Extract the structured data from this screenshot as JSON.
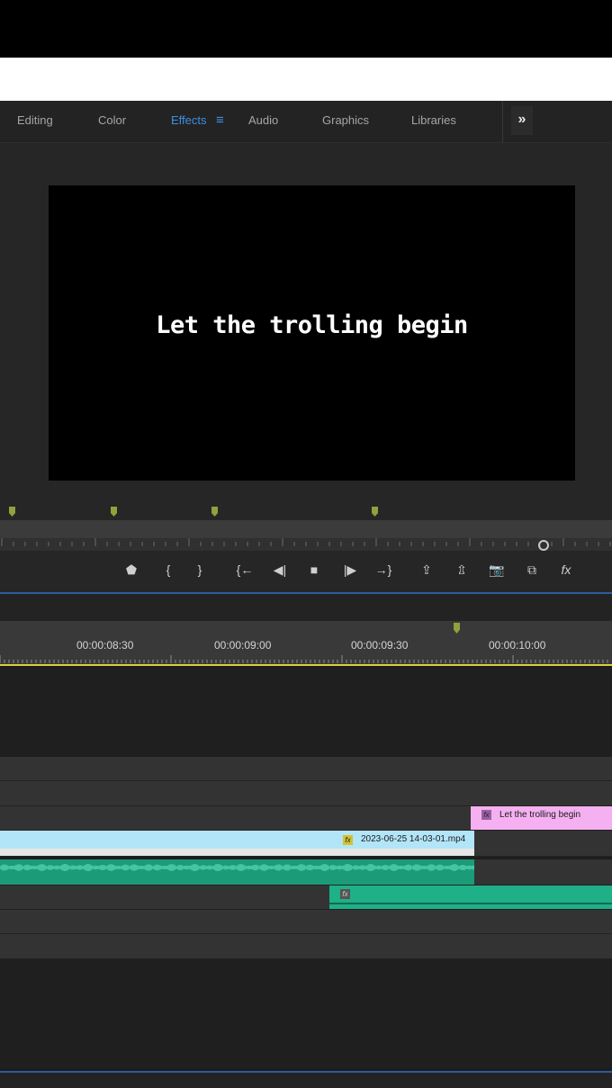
{
  "workspace_tabs": [
    {
      "label": "Editing",
      "active": false
    },
    {
      "label": "Color",
      "active": false
    },
    {
      "label": "Effects",
      "active": true
    },
    {
      "label": "Audio",
      "active": false
    },
    {
      "label": "Graphics",
      "active": false
    },
    {
      "label": "Libraries",
      "active": false
    }
  ],
  "workspace_menu_icon": "≡",
  "overflow_icon": "»",
  "preview": {
    "text": "Let the trolling begin"
  },
  "transport_icons": {
    "add_marker": "⬟",
    "mark_in": "{",
    "mark_out": "}",
    "go_to_in": "{←",
    "step_back": "◀|",
    "stop": "■",
    "step_forward": "|▶",
    "go_to_out": "→}",
    "lift": "⇪",
    "extract": "⇫",
    "export_frame": "📷",
    "comparison": "⧉",
    "fx": "fx"
  },
  "timeline": {
    "timecodes": [
      "00:00:08:30",
      "00:00:09:00",
      "00:00:09:30",
      "00:00:10:00"
    ]
  },
  "clips": {
    "title_clip": {
      "fx": "fx",
      "label": "Let the trolling begin"
    },
    "video_clip": {
      "fx": "fx",
      "label": "2023-06-25 14-03-01.mp4"
    },
    "audio_clip2": {
      "fx": "fx"
    }
  },
  "colors": {
    "accent": "#3d8fe0",
    "title_clip": "#f4b0f0",
    "video_clip": "#b2e5f7",
    "audio_clip": "#1b9b77",
    "marker": "#8ea23d"
  }
}
